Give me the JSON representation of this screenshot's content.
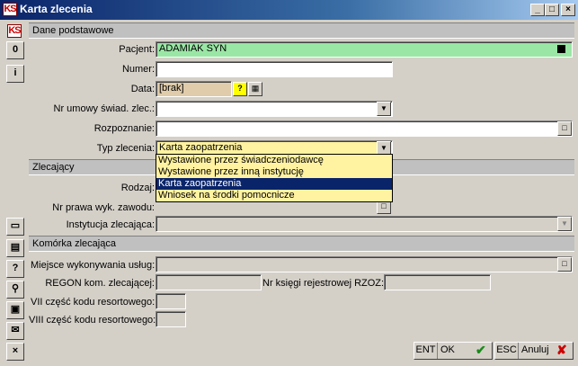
{
  "window": {
    "title": "Karta zlecenia",
    "logo_text": "KS"
  },
  "toolbar": {
    "top_buttons": [
      "0",
      "i"
    ],
    "bottom_buttons": [
      "?",
      "×"
    ]
  },
  "sections": {
    "basic": "Dane podstawowe",
    "ordering": "Zlecający",
    "unit": "Komórka zlecająca"
  },
  "fields": {
    "patient_label": "Pacjent:",
    "patient_value": "ADAMIAK SYN",
    "number_label": "Numer:",
    "number_value": "",
    "date_label": "Data:",
    "date_value": "[brak]",
    "date_help": "?",
    "contract_label": "Nr umowy świad. zlec.:",
    "diagnosis_label": "Rozpoznanie:",
    "order_type_label": "Typ zlecenia:",
    "order_type_value": "Karta zaopatrzenia",
    "kind_label": "Rodzaj:",
    "license_label": "Nr prawa wyk. zawodu:",
    "institution_label": "Instytucja zlecająca:",
    "place_label": "Miejsce wykonywania usług:",
    "regon_label": "REGON kom. zlecającej:",
    "rzoz_label": "Nr księgi rejestrowej RZOZ:",
    "vii_label": "VII część kodu resortowego:",
    "viii_label": "VIII część kodu resortowego:"
  },
  "dropdown": {
    "options": [
      "Wystawione przez świadczeniodawcę",
      "Wystawione przez inną instytucję",
      "Karta zaopatrzenia",
      "Wniosek na środki pomocnicze"
    ],
    "selected_index": 2
  },
  "buttons": {
    "ok_key": "ENT",
    "ok_label": "OK",
    "cancel_key": "ESC",
    "cancel_label": "Anuluj"
  },
  "colors": {
    "title_bar": "#0a246a",
    "patient_bg": "#9ae6a5",
    "combo_bg": "#fff2a0",
    "selected": "#0a246a"
  }
}
